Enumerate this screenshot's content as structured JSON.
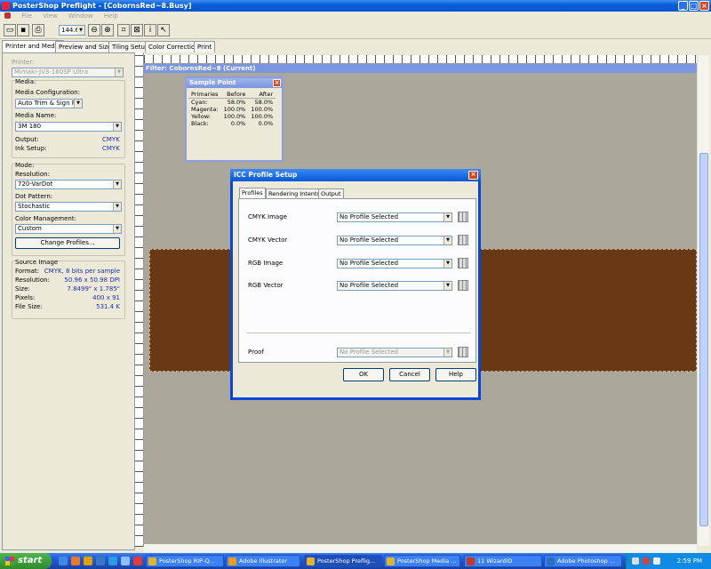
{
  "window": {
    "title": "PosterShop Preflight - [CobornsRed~8.Busy]"
  },
  "menu": [
    "File",
    "View",
    "Window",
    "Help"
  ],
  "toolbar": {
    "zoom_value": "144.6"
  },
  "tabs": [
    "Printer and Media",
    "Preview and Size",
    "Tiling Setup",
    "Color Correction",
    "Print"
  ],
  "left_panel": {
    "printer_label": "Printer:",
    "printer_value": "Mimaki-JV3-160SP Ultra",
    "media_heading": "Media:",
    "media_config_label": "Media Configuration:",
    "media_config_value": "Auto Trim & Sign Pro",
    "media_name_label": "Media Name:",
    "media_name_value": "3M 180",
    "output_label": "Output:",
    "output_value": "CMYK",
    "ink_label": "Ink Setup:",
    "ink_value": "CMYK",
    "mode_heading": "Mode:",
    "resolution_label": "Resolution:",
    "resolution_value": "720-VarDot",
    "dot_label": "Dot Pattern:",
    "dot_value": "Stochastic",
    "cm_label": "Color Management:",
    "cm_value": "Custom",
    "change_profiles": "Change Profiles...",
    "source_heading": "Source Image",
    "source_rows": [
      {
        "k": "Format:",
        "v": "CMYK, 8 bits per sample"
      },
      {
        "k": "Resolution:",
        "v": "50.96 x 50.98 DPI"
      },
      {
        "k": "Size:",
        "v": "7.8499\" x 1.785\""
      },
      {
        "k": "Pixels:",
        "v": "400 x 91"
      },
      {
        "k": "File Size:",
        "v": "531.4 K"
      }
    ]
  },
  "canvas": {
    "header": "Filter: CobornsRed~8 (Current)",
    "image_color": "#693915"
  },
  "sample_point": {
    "title": "Sample Point",
    "headers": [
      "Primaries",
      "Before",
      "After"
    ],
    "rows": [
      [
        "Cyan:",
        "58.0%",
        "58.0%"
      ],
      [
        "Magenta:",
        "100.0%",
        "100.0%"
      ],
      [
        "Yellow:",
        "100.0%",
        "100.0%"
      ],
      [
        "Black:",
        "0.0%",
        "0.0%"
      ]
    ]
  },
  "dialog": {
    "title": "ICC Profile Setup",
    "tabs": [
      "Profiles",
      "Rendering Intents",
      "Output"
    ],
    "rows": [
      {
        "label": "CMYK Image",
        "value": "No Profile Selected"
      },
      {
        "label": "CMYK Vector",
        "value": "No Profile Selected"
      },
      {
        "label": "RGB Image",
        "value": "No Profile Selected"
      },
      {
        "label": "RGB Vector",
        "value": "No Profile Selected"
      }
    ],
    "proof_label": "Proof",
    "proof_value": "No Profile Selected",
    "ok": "OK",
    "cancel": "Cancel",
    "help": "Help"
  },
  "taskbar": {
    "start": "start",
    "items": [
      "PosterShop RIP-Q...",
      "Adobe Illustrator",
      "PosterShop Preflig...",
      "PosterShop Media ...",
      "11 WizardID",
      "Adobe Photoshop ..."
    ],
    "clock": "2:59 PM"
  }
}
